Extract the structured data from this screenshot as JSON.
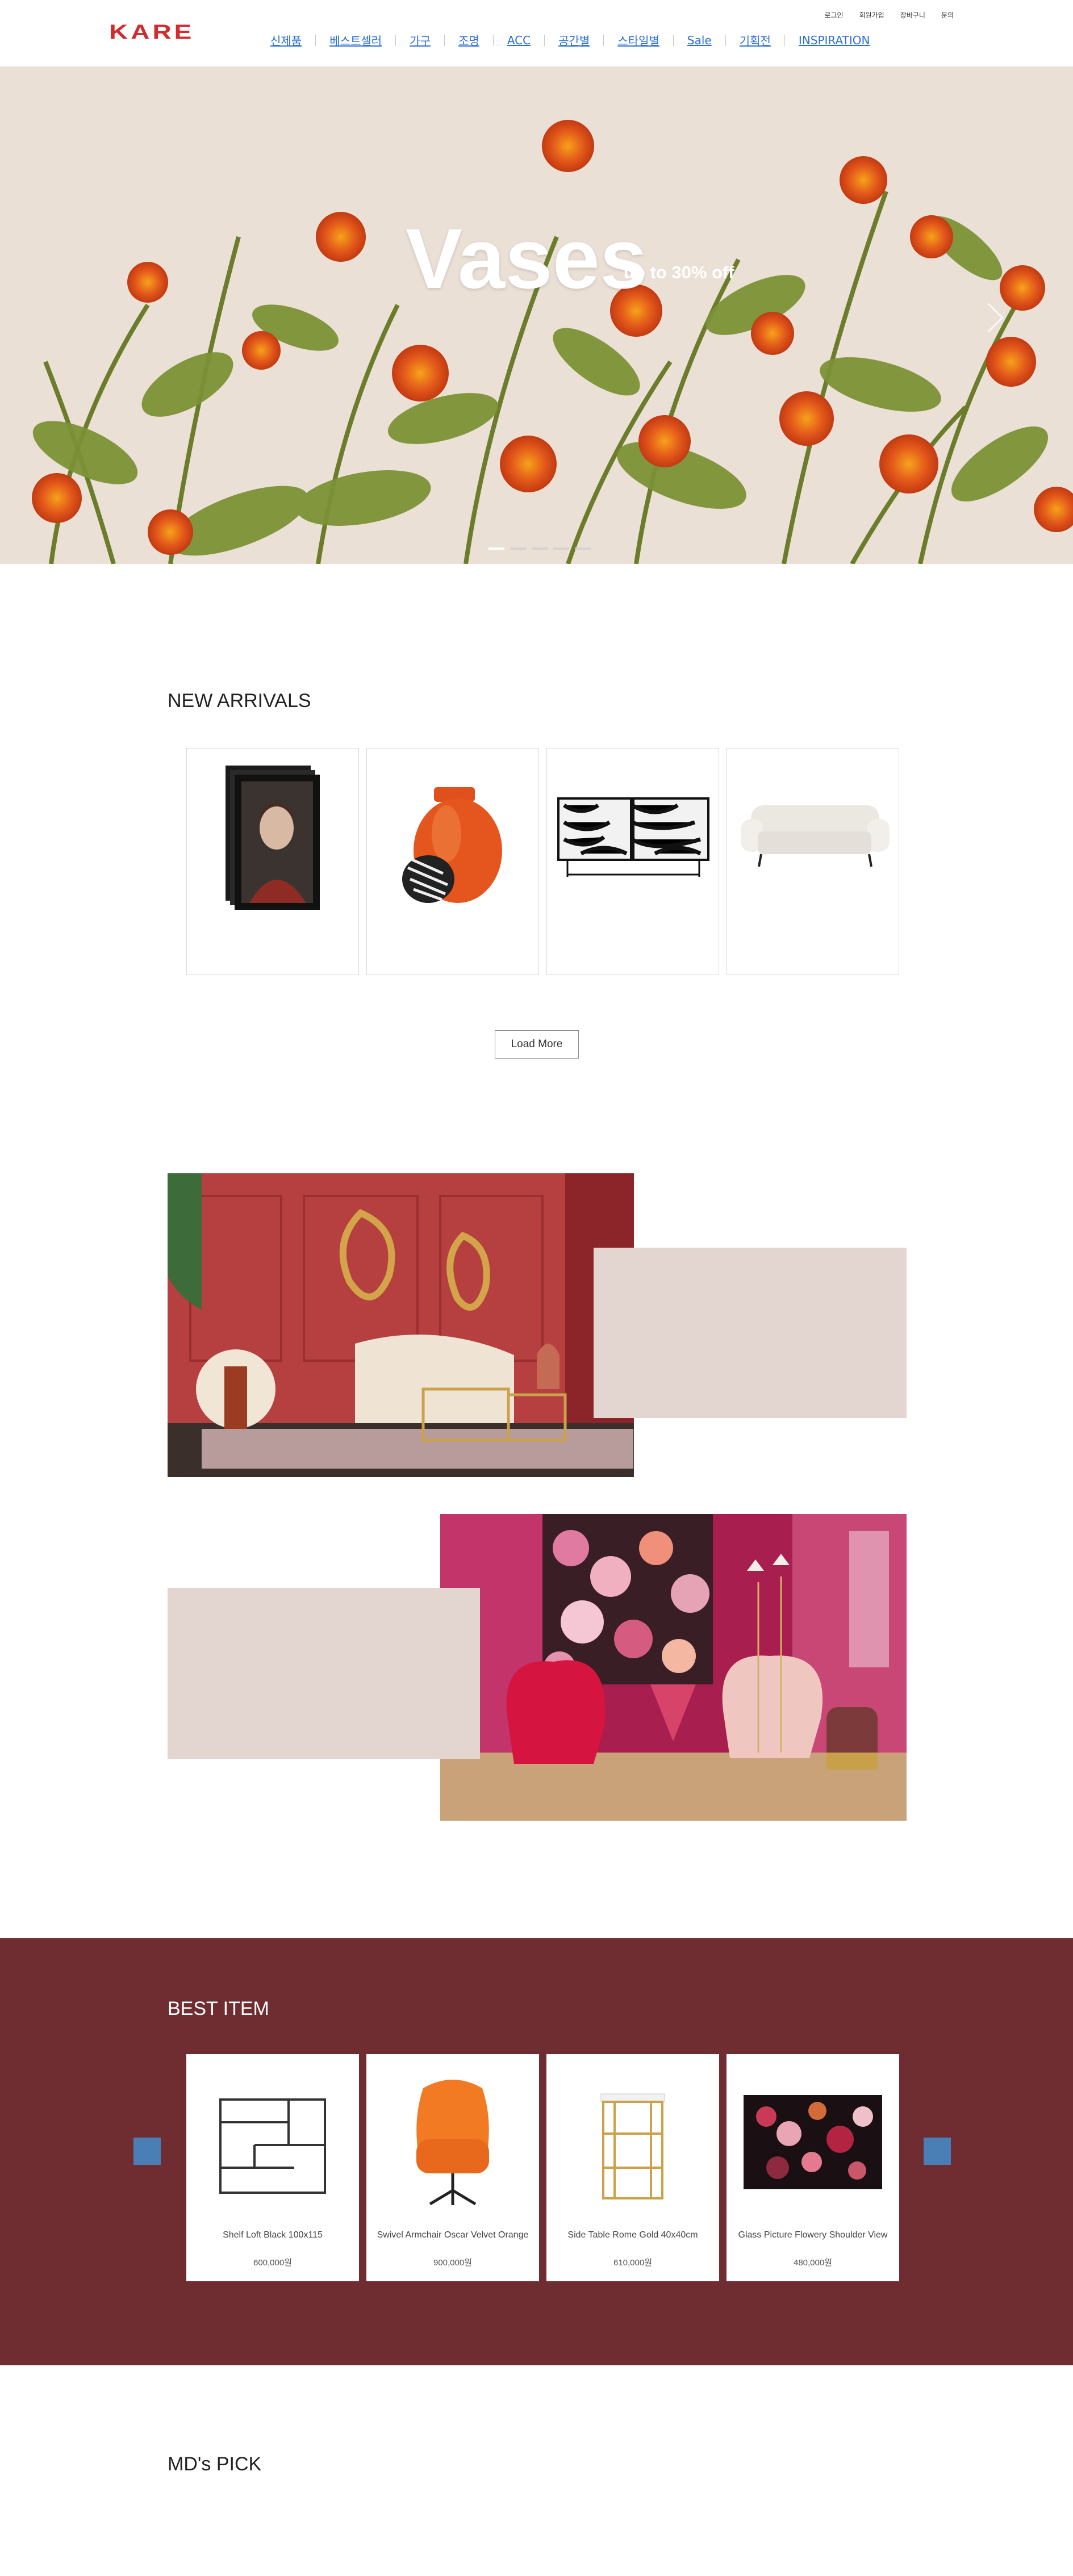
{
  "header": {
    "logo": "KARE",
    "nav": [
      "신제품",
      "베스트셀러",
      "가구",
      "조명",
      "ACC",
      "공간별",
      "스타일별",
      "Sale",
      "기획전",
      "INSPIRATION"
    ],
    "util": [
      "로그인",
      "회원가입",
      "장바구니",
      "문의"
    ]
  },
  "hero": {
    "title": "Vases",
    "subtitle": "up to 30% off",
    "slide_count": 5,
    "active_slide": 1
  },
  "new_arrivals": {
    "title": "NEW ARRIVALS",
    "load_more": "Load More",
    "items": [
      {
        "image": "portrait-painting"
      },
      {
        "image": "orange-vase"
      },
      {
        "image": "zebra-sideboard"
      },
      {
        "image": "white-sofa"
      }
    ]
  },
  "best_item": {
    "title": "BEST ITEM",
    "items": [
      {
        "name": "Shelf Loft Black 100x115",
        "price": "600,000원",
        "image": "black-shelf"
      },
      {
        "name": "Swivel Armchair Oscar Velvet Orange",
        "price": "900,000원",
        "image": "orange-armchair"
      },
      {
        "name": "Side Table Rome Gold 40x40cm",
        "price": "610,000원",
        "image": "gold-side-table"
      },
      {
        "name": "Glass Picture Flowery Shoulder View",
        "price": "480,000원",
        "image": "flower-picture"
      }
    ]
  },
  "mds_pick": {
    "title": "MD's PICK"
  },
  "colors": {
    "logo": "#d22a2f",
    "nav_link": "#2c6fd6",
    "best_bg": "#6f2d31",
    "accent_box": "#e3d5cf",
    "slider_button": "#4a7fb5"
  }
}
